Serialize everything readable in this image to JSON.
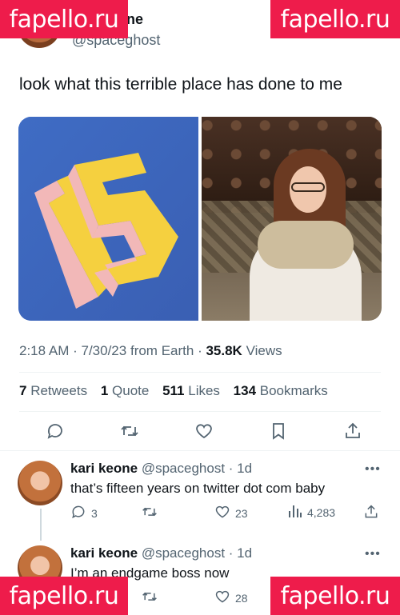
{
  "author": {
    "name": "kari keone",
    "handle": "@spaceghost"
  },
  "tweet": {
    "text": "look what this terrible place has done to me",
    "media_left_number": "15",
    "time": "2:18 AM",
    "date": "7/30/23",
    "source": "from Earth",
    "views_count": "35.8K",
    "views_label": "Views"
  },
  "stats": {
    "retweets_count": "7",
    "retweets_label": "Retweets",
    "quotes_count": "1",
    "quotes_label": "Quote",
    "likes_count": "511",
    "likes_label": "Likes",
    "bookmarks_count": "134",
    "bookmarks_label": "Bookmarks"
  },
  "actions": [
    "reply-icon",
    "retweet-icon",
    "like-icon",
    "bookmark-icon",
    "share-icon"
  ],
  "replies": [
    {
      "name": "kari keone",
      "handle": "@spaceghost",
      "age": "1d",
      "text": "that’s fifteen years on twitter dot com baby",
      "reply_count": "3",
      "retweet_count": "",
      "like_count": "23",
      "view_count": "4,283"
    },
    {
      "name": "kari keone",
      "handle": "@spaceghost",
      "age": "1d",
      "text": "I’m an endgame boss now",
      "reply_count": "",
      "retweet_count": "",
      "like_count": "28",
      "view_count": ""
    }
  ],
  "watermark": {
    "text": "fapello.ru"
  },
  "colors": {
    "accent": "#1d9bf0",
    "muted": "#536471",
    "watermark": "#ee1c4b",
    "media_blue": "#4472c4",
    "number_yellow": "#f5c542"
  }
}
